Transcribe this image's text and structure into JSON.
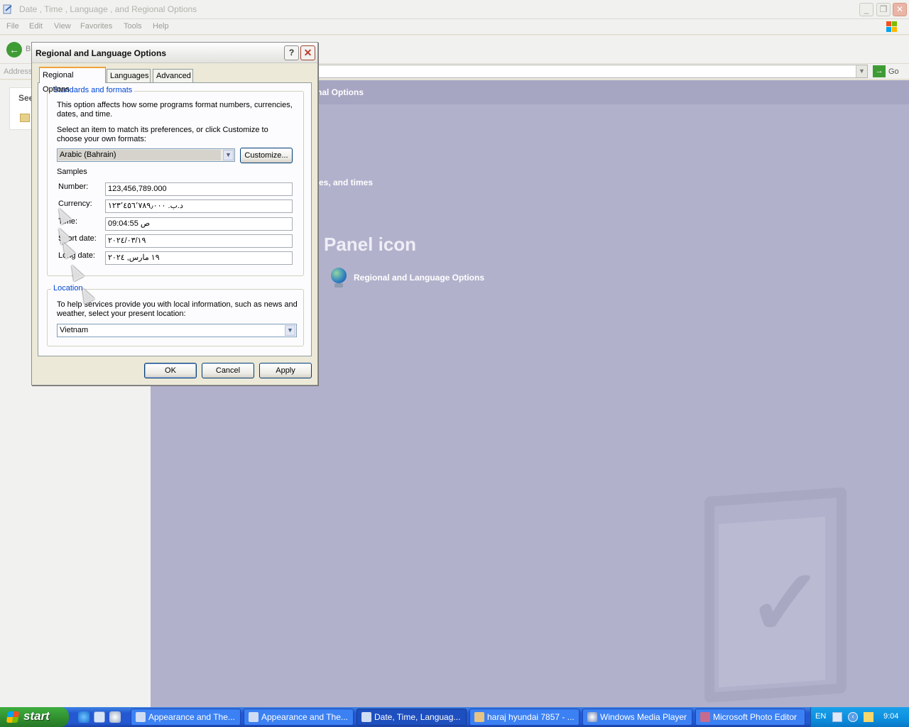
{
  "window": {
    "title": "Date , Time , Language , and Regional Options",
    "minimize": "_",
    "restore": "❐",
    "close": "✕"
  },
  "menu": [
    "File",
    "Edit",
    "View",
    "Favorites",
    "Tools",
    "Help"
  ],
  "toolbar": {
    "back_label": "B"
  },
  "address": {
    "label": "Address",
    "go_label": "Go"
  },
  "taskpane": {
    "see_also": "See"
  },
  "content": {
    "header": "nal Options",
    "task_fragment": "tes, and times",
    "heading": "Panel icon",
    "cp_item": "Regional and Language Options"
  },
  "dialog": {
    "title": "Regional and Language Options",
    "help": "?",
    "close": "✕",
    "tabs": [
      "Regional Options",
      "Languages",
      "Advanced"
    ],
    "standards": {
      "legend": "Standards and formats",
      "desc": "This option affects how some programs format numbers, currencies, dates, and time.",
      "select_desc": "Select an item to match its preferences, or click Customize to choose your own formats:",
      "format_value": "Arabic (Bahrain)",
      "customize_label": "Customize...",
      "samples_label": "Samples",
      "samples": [
        {
          "label": "Number:",
          "value": "123,456,789.000"
        },
        {
          "label": "Currency:",
          "value": "د.ب.‏ ١٢٣٬٤٥٦٬٧٨٩٫٠٠٠"
        },
        {
          "label": "Time:",
          "value": "09:04:55 ص"
        },
        {
          "label": "Short date:",
          "value": "٢٠٢٤/٠٣/١٩"
        },
        {
          "label": "Long date:",
          "value": "١٩ مارس, ٢٠٢٤"
        }
      ]
    },
    "location": {
      "legend": "Location",
      "desc": "To help services provide you with local information, such as news and weather, select your present location:",
      "value": "Vietnam"
    },
    "buttons": {
      "ok": "OK",
      "cancel": "Cancel",
      "apply": "Apply"
    }
  },
  "taskbar": {
    "start": "start",
    "items": [
      {
        "label": "Appearance and The...",
        "active": false
      },
      {
        "label": "Appearance and The...",
        "active": false
      },
      {
        "label": "Date, Time, Languag...",
        "active": true
      },
      {
        "label": "haraj hyundai 7857 - ...",
        "active": false
      },
      {
        "label": "Windows Media Player",
        "active": false
      },
      {
        "label": "Microsoft Photo Editor",
        "active": false
      }
    ],
    "lang": "EN",
    "clock": "9:04"
  },
  "colors": {
    "content_bg": "#b2b1cc",
    "taskbar": "#2458d2",
    "start": "#2f8d2f",
    "legend": "#0046d5"
  }
}
